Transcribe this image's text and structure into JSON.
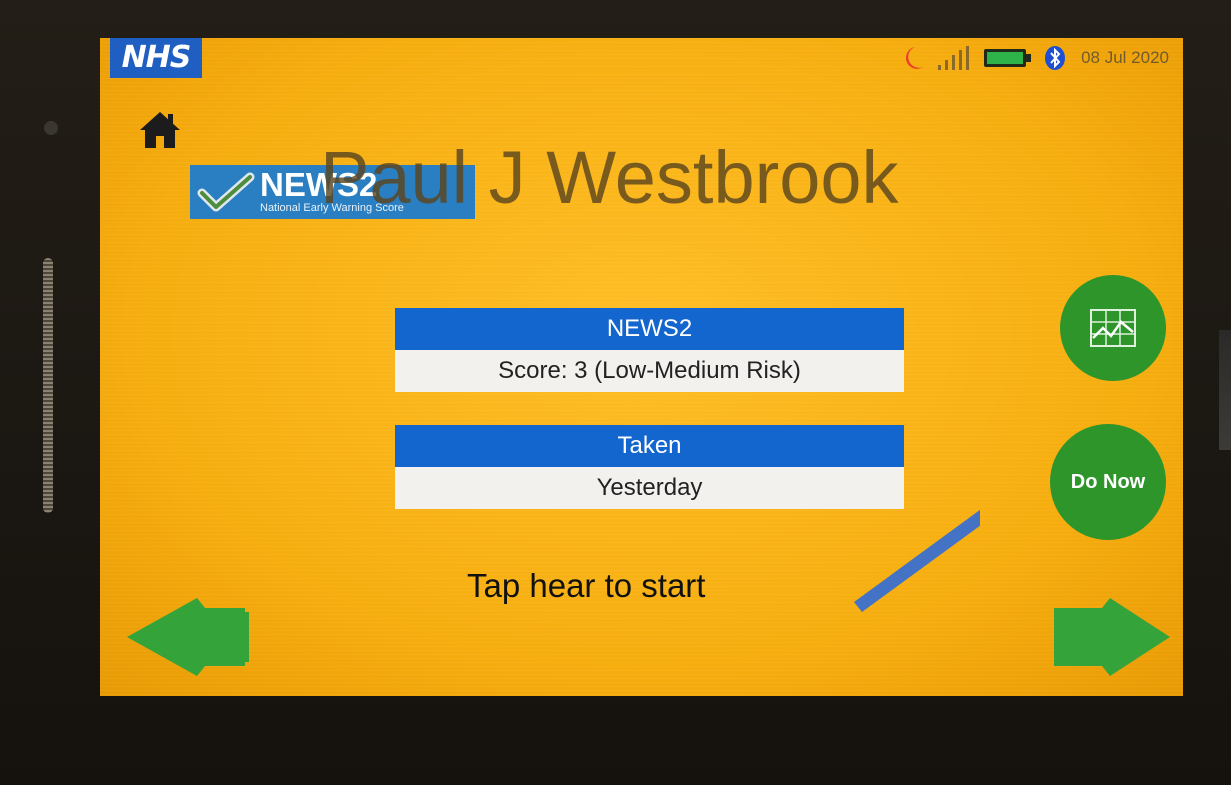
{
  "device": {
    "logo_text": "NHS",
    "status_bar": {
      "icons": [
        "moon-icon",
        "signal-icon",
        "battery-icon",
        "bluetooth-icon"
      ],
      "date": "08 Jul 2020"
    }
  },
  "header": {
    "home_icon": "home-icon",
    "news2_logo": {
      "title": "NEWS2",
      "subtitle": "National Early Warning Score"
    },
    "patient_name": "Paul J Westbrook"
  },
  "main": {
    "news2_card": {
      "heading": "NEWS2",
      "value": "Score: 3 (Low-Medium Risk)"
    },
    "taken_card": {
      "heading": "Taken",
      "value": "Yesterday"
    }
  },
  "actions": {
    "chart_button_icon": "line-chart-icon",
    "do_now_label": "Do Now",
    "prev_icon": "arrow-left-icon",
    "next_icon": "arrow-right-icon"
  },
  "annotation": {
    "text": "Tap hear to start"
  },
  "colors": {
    "screen_bg": "#f6ad0e",
    "card_header": "#1466cf",
    "card_body": "#f2f1ee",
    "button_green": "#2d952a",
    "nhs_blue": "#1f5fc2",
    "callout_arrow": "#4472c4"
  }
}
